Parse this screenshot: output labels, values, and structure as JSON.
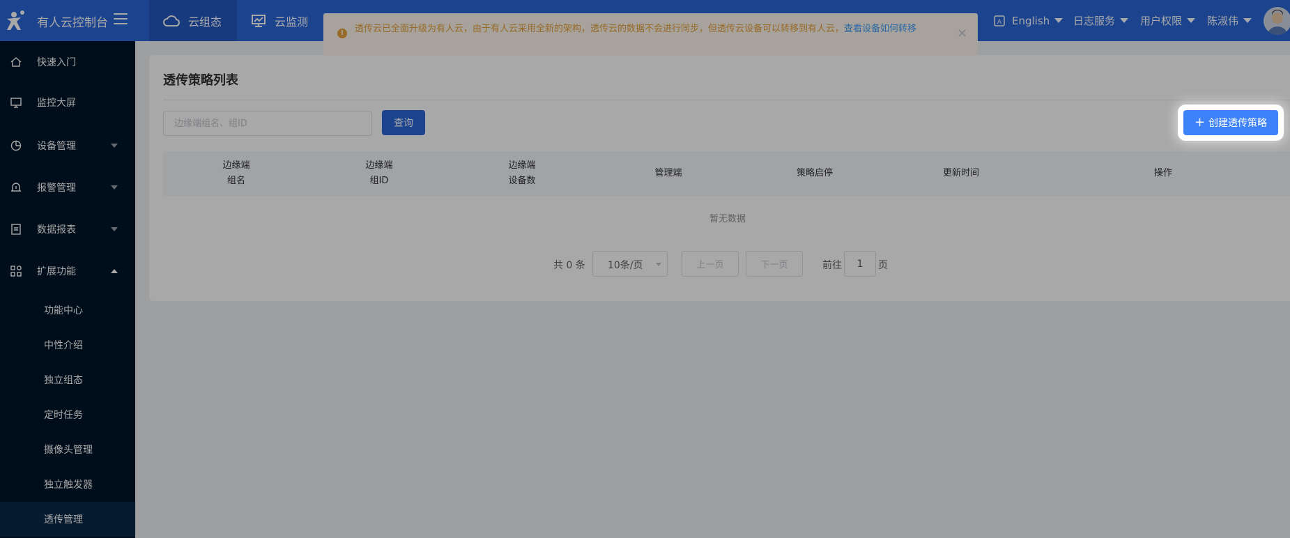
{
  "header": {
    "brand": "有人云控制台",
    "nav": [
      {
        "label": "云组态",
        "active": true
      },
      {
        "label": "云监测",
        "active": false
      }
    ],
    "language": "English",
    "log_service": "日志服务",
    "user_permissions": "用户权限",
    "username": "陈淑伟"
  },
  "notice": {
    "text": "透传云已全面升级为有人云，由于有人云采用全新的架构，透传云的数据不会进行同步，但透传云设备可以转移到有人云，",
    "link": "查看设备如何转移",
    "close": "×"
  },
  "sidebar": {
    "items": [
      {
        "label": "快速入门",
        "icon": "home-icon"
      },
      {
        "label": "监控大屏",
        "icon": "monitor-icon"
      },
      {
        "label": "设备管理",
        "icon": "device-icon"
      },
      {
        "label": "报警管理",
        "icon": "alarm-icon"
      },
      {
        "label": "数据报表",
        "icon": "report-icon"
      },
      {
        "label": "扩展功能",
        "icon": "extension-icon"
      }
    ],
    "sub_items": [
      "功能中心",
      "中性介绍",
      "独立组态",
      "定时任务",
      "摄像头管理",
      "独立触发器",
      "透传管理"
    ],
    "selected": "透传管理"
  },
  "main": {
    "title": "透传策略列表",
    "search_placeholder": "边缘端组名、组ID",
    "query_label": "查询",
    "create_label": "创建透传策略",
    "columns": [
      {
        "line1": "边缘端",
        "line2": "组名"
      },
      {
        "line1": "边缘端",
        "line2": "组ID"
      },
      {
        "line1": "边缘端",
        "line2": "设备数"
      },
      {
        "line1": "管理端",
        "line2": ""
      },
      {
        "line1": "策略启停",
        "line2": ""
      },
      {
        "line1": "更新时间",
        "line2": ""
      },
      {
        "line1": "操作",
        "line2": ""
      }
    ],
    "empty_text": "暂无数据"
  },
  "pagination": {
    "total": "共 0 条",
    "page_size": "10条/页",
    "prev": "上一页",
    "next": "下一页",
    "goto": "前往",
    "page": "1",
    "suffix": "页"
  },
  "colors": {
    "header_bg": "#2a66d8",
    "sidebar_bg": "#001529",
    "primary": "#3d82f8",
    "warning": "#e6a23c"
  }
}
